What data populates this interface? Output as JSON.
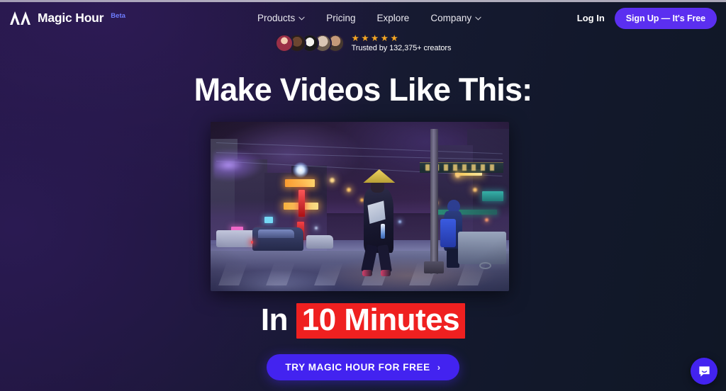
{
  "nav": {
    "brand_name": "Magic Hour",
    "brand_badge": "Beta",
    "logo_icon": "magic-hour-logo-icon",
    "links": [
      {
        "label": "Products",
        "has_caret": true
      },
      {
        "label": "Pricing",
        "has_caret": false
      },
      {
        "label": "Explore",
        "has_caret": false
      },
      {
        "label": "Company",
        "has_caret": true
      }
    ],
    "login_label": "Log In",
    "signup_label": "Sign Up — It's Free"
  },
  "social_proof": {
    "avatar_count": 5,
    "avatar_labels": [
      "creator-avatar-1",
      "creator-avatar-2",
      "creator-avatar-3",
      "creator-avatar-4",
      "creator-avatar-5"
    ],
    "star_count": 5,
    "star_glyph": "★",
    "trusted_text": "Trusted by 132,375+ creators"
  },
  "hero": {
    "headline": "Make Videos Like This:",
    "subhead_prefix": "In",
    "subhead_highlight": "10 Minutes",
    "video_alt": "Animated neon-lit night street scene with a figure in a yellow conical hat crossing the road"
  },
  "cta": {
    "label": "TRY MAGIC HOUR FOR FREE",
    "arrow": "›"
  },
  "chat": {
    "icon": "chat-bubble-icon"
  },
  "colors": {
    "accent_purple": "#4323f0",
    "signup_purple": "#5b2ff0",
    "beta_blue": "#6e7dff",
    "highlight_red": "#ef2020",
    "star_gold": "#f5a623",
    "bg_left": "#221542",
    "bg_right": "#101726"
  }
}
